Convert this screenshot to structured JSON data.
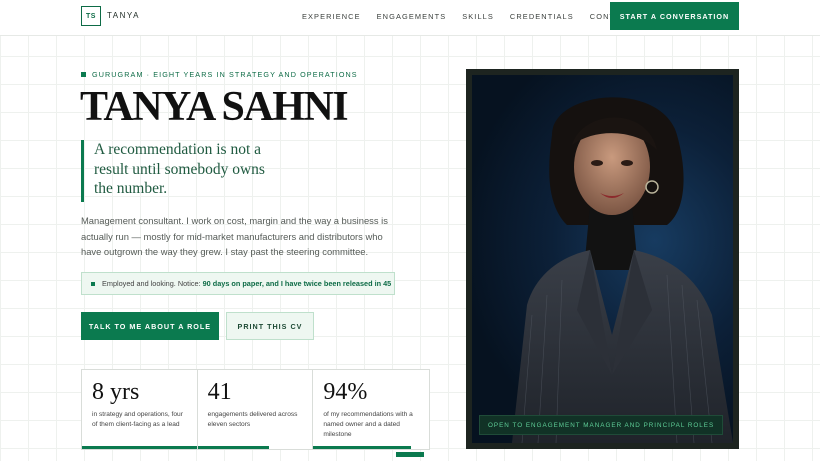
{
  "nav": {
    "logo_initials": "TS",
    "logo_name": "TANYA",
    "links": [
      "EXPERIENCE",
      "ENGAGEMENTS",
      "SKILLS",
      "CREDENTIALS",
      "CONTACT"
    ],
    "cta": "START A CONVERSATION"
  },
  "hero": {
    "eyebrow": "GURUGRAM · EIGHT YEARS IN STRATEGY AND OPERATIONS",
    "name": "TANYA SAHNI",
    "quote": "A recommendation is not a result until somebody owns the number.",
    "bio": "Management consultant. I work on cost, margin and the way a business is actually run — mostly for mid-market manufacturers and distributors who have outgrown the way they grew. I stay past the steering committee.",
    "notice_prefix": "Employed and looking. Notice:",
    "notice_emphasis": "90 days on paper, and I have twice been released in 45",
    "primary_button": "TALK TO ME ABOUT A ROLE",
    "secondary_button": "PRINT THIS CV"
  },
  "stats": [
    {
      "value": "8 yrs",
      "desc": "in strategy and operations, four of them client-facing as a lead",
      "bar_fraction": 1.0
    },
    {
      "value": "41",
      "desc": "engagements delivered across eleven sectors",
      "bar_fraction": 0.62
    },
    {
      "value": "94%",
      "desc": "of my recommendations with a named owner and a dated milestone",
      "bar_fraction": 0.84
    }
  ],
  "portrait": {
    "badge": "OPEN TO ENGAGEMENT MANAGER AND PRINCIPAL ROLES"
  },
  "colors": {
    "accent": "#0b7a4f",
    "accent_light": "#eef7f1",
    "portrait_bg": "#0c2038"
  }
}
